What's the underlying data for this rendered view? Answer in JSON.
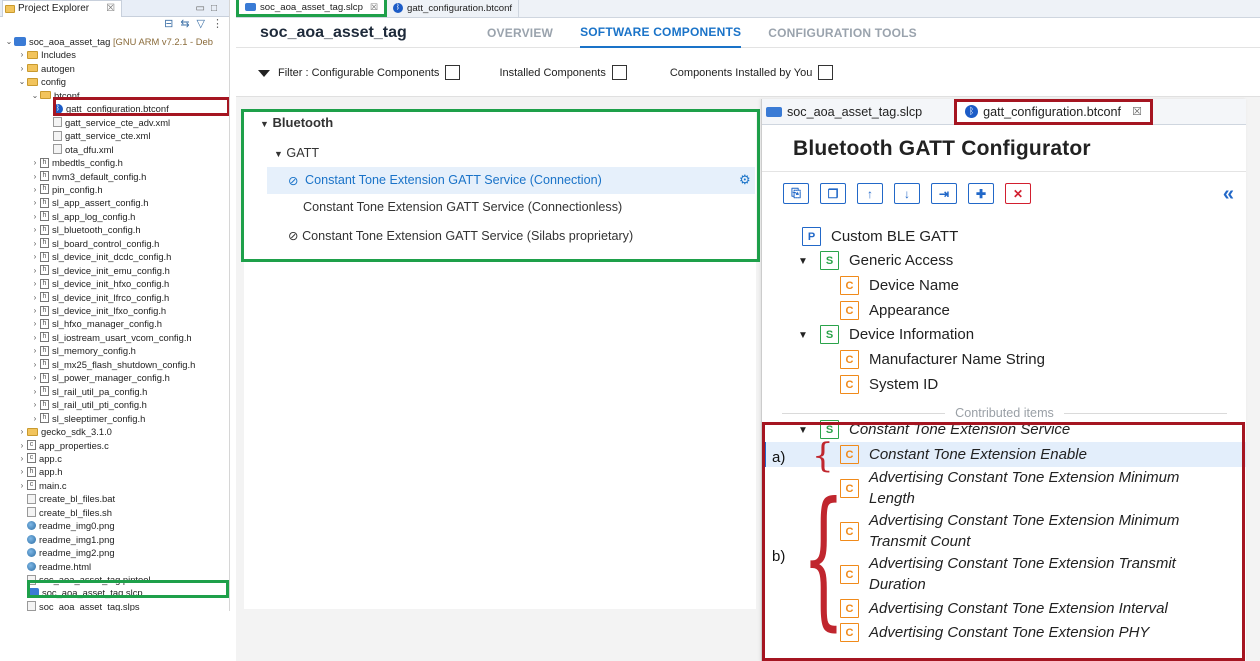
{
  "project_explorer": {
    "title": "Project Explorer",
    "root": "soc_aoa_asset_tag",
    "root_suffix": "[GNU ARM v7.2.1 - Deb",
    "items": [
      {
        "label": "Includes",
        "kind": "folder"
      },
      {
        "label": "autogen",
        "kind": "folder"
      },
      {
        "label": "config",
        "kind": "folder"
      },
      {
        "label": "btconf",
        "kind": "folder"
      },
      {
        "label": "gatt_configuration.btconf",
        "kind": "bt"
      },
      {
        "label": "gatt_service_cte_adv.xml",
        "kind": "xml"
      },
      {
        "label": "gatt_service_cte.xml",
        "kind": "xml"
      },
      {
        "label": "ota_dfu.xml",
        "kind": "xml"
      },
      {
        "label": "mbedtls_config.h",
        "kind": "h"
      },
      {
        "label": "nvm3_default_config.h",
        "kind": "h"
      },
      {
        "label": "pin_config.h",
        "kind": "h"
      },
      {
        "label": "sl_app_assert_config.h",
        "kind": "h"
      },
      {
        "label": "sl_app_log_config.h",
        "kind": "h"
      },
      {
        "label": "sl_bluetooth_config.h",
        "kind": "h"
      },
      {
        "label": "sl_board_control_config.h",
        "kind": "h"
      },
      {
        "label": "sl_device_init_dcdc_config.h",
        "kind": "h"
      },
      {
        "label": "sl_device_init_emu_config.h",
        "kind": "h"
      },
      {
        "label": "sl_device_init_hfxo_config.h",
        "kind": "h"
      },
      {
        "label": "sl_device_init_lfrco_config.h",
        "kind": "h"
      },
      {
        "label": "sl_device_init_lfxo_config.h",
        "kind": "h"
      },
      {
        "label": "sl_hfxo_manager_config.h",
        "kind": "h"
      },
      {
        "label": "sl_iostream_usart_vcom_config.h",
        "kind": "h"
      },
      {
        "label": "sl_memory_config.h",
        "kind": "h"
      },
      {
        "label": "sl_mx25_flash_shutdown_config.h",
        "kind": "h"
      },
      {
        "label": "sl_power_manager_config.h",
        "kind": "h"
      },
      {
        "label": "sl_rail_util_pa_config.h",
        "kind": "h"
      },
      {
        "label": "sl_rail_util_pti_config.h",
        "kind": "h"
      },
      {
        "label": "sl_sleeptimer_config.h",
        "kind": "h"
      },
      {
        "label": "gecko_sdk_3.1.0",
        "kind": "folder"
      },
      {
        "label": "app_properties.c",
        "kind": "c"
      },
      {
        "label": "app.c",
        "kind": "c"
      },
      {
        "label": "app.h",
        "kind": "h"
      },
      {
        "label": "main.c",
        "kind": "c"
      },
      {
        "label": "create_bl_files.bat",
        "kind": "file"
      },
      {
        "label": "create_bl_files.sh",
        "kind": "file"
      },
      {
        "label": "readme_img0.png",
        "kind": "png"
      },
      {
        "label": "readme_img1.png",
        "kind": "png"
      },
      {
        "label": "readme_img2.png",
        "kind": "png"
      },
      {
        "label": "readme.html",
        "kind": "png"
      },
      {
        "label": "soc_aoa_asset_tag.pintool",
        "kind": "file"
      },
      {
        "label": "soc_aoa_asset_tag.slcp",
        "kind": "proj"
      },
      {
        "label": "soc_aoa_asset_tag.slps",
        "kind": "file"
      }
    ]
  },
  "editor": {
    "tabs": [
      "soc_aoa_asset_tag.slcp",
      "gatt_configuration.btconf"
    ],
    "project_name": "soc_aoa_asset_tag",
    "header_tabs": [
      "OVERVIEW",
      "SOFTWARE COMPONENTS",
      "CONFIGURATION TOOLS"
    ],
    "filter_label": "Filter :",
    "filters": [
      "Configurable Components",
      "Installed Components",
      "Components Installed by You"
    ]
  },
  "components": {
    "category": "Bluetooth",
    "subcategory": "GATT",
    "items": [
      "Constant Tone Extension GATT Service (Connection)",
      "Constant Tone Extension GATT Service (Connectionless)",
      "Constant Tone Extension GATT Service (Silabs proprietary)"
    ]
  },
  "gatt": {
    "tabs": [
      "soc_aoa_asset_tag.slcp",
      "gatt_configuration.btconf"
    ],
    "title": "Bluetooth GATT Configurator",
    "profile": "Custom BLE GATT",
    "services": [
      {
        "name": "Generic Access",
        "characteristics": [
          "Device Name",
          "Appearance"
        ]
      },
      {
        "name": "Device Information",
        "characteristics": [
          "Manufacturer Name String",
          "System ID"
        ]
      }
    ],
    "contributed_label": "Contributed items",
    "contributed_service": "Constant Tone Extension Service",
    "contributed_characteristics": [
      "Constant Tone Extension Enable",
      "Advertising Constant Tone Extension Minimum Length",
      "Advertising Constant Tone Extension Minimum Transmit Count",
      "Advertising Constant Tone Extension Transmit Duration",
      "Advertising Constant Tone Extension Interval",
      "Advertising Constant Tone Extension PHY"
    ],
    "badges": {
      "profile": "P",
      "service": "S",
      "characteristic": "C"
    }
  },
  "annotations": {
    "a": "a)",
    "b": "b)"
  },
  "colors": {
    "highlight_red": "#a51521",
    "highlight_green": "#1ea04a",
    "accent_blue": "#1a73c8",
    "char_orange": "#f08a1a",
    "service_green": "#2aa34a"
  }
}
